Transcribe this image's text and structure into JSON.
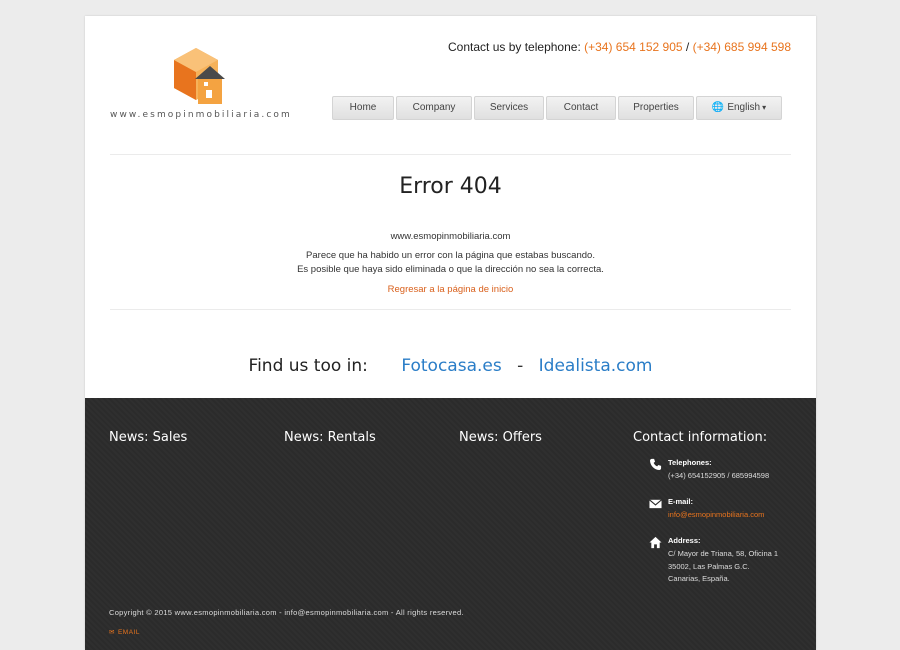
{
  "header": {
    "logo_text": "www.esmopinmobiliaria.com",
    "contact_prefix": "Contact us by telephone:",
    "phone_1": "(+34) 654 152 905",
    "phone_sep": "/",
    "phone_2": "(+34) 685 994 598"
  },
  "nav": {
    "items": [
      "Home",
      "Company",
      "Services",
      "Contact",
      "Properties"
    ],
    "language": "English"
  },
  "error": {
    "title": "Error 404",
    "site": "www.esmopinmobiliaria.com",
    "line1": "Parece que ha habido un error con la página que estabas buscando.",
    "line2": "Es posible que haya sido eliminada o que la dirección no sea la correcta.",
    "home_link": "Regresar a la página de inicio"
  },
  "find_us": {
    "label": "Find us too in:",
    "link1": "Fotocasa.es",
    "sep": "-",
    "link2": "Idealista.com"
  },
  "footer": {
    "col1": "News: Sales",
    "col2": "News: Rentals",
    "col3": "News: Offers",
    "col4": "Contact information:",
    "telephones_label": "Telephones:",
    "telephones_value": "(+34) 654152905 / 685994598",
    "email_label": "E-mail:",
    "email_value": "info@esmopinmobiliaria.com",
    "address_label": "Address:",
    "address_line1": "C/ Mayor de Triana, 58, Oficina 1",
    "address_line2": "35002, Las Palmas G.C.",
    "address_line3": "Canarias, España.",
    "copyright": "Copyright © 2015 www.esmopinmobiliaria.com - info@esmopinmobiliaria.com - All rights reserved.",
    "email_link": "EMAIL"
  },
  "colors": {
    "accent": "#e8741e",
    "link_blue": "#2a7dc7",
    "footer_bg": "#2b2b2b"
  }
}
